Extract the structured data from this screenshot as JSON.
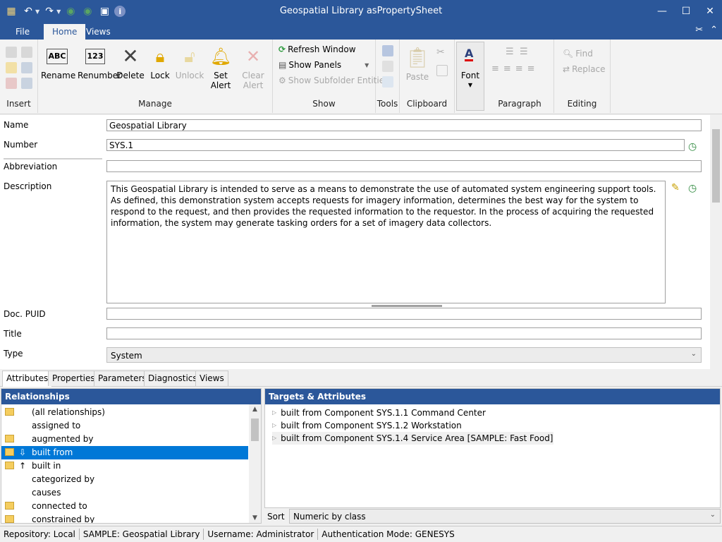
{
  "window": {
    "title": "Geospatial Library asPropertySheet"
  },
  "ribbon": {
    "tabs": [
      "File",
      "Home",
      "Views"
    ],
    "manage": {
      "rename": "Rename",
      "renumber": "Renumber",
      "delete": "Delete",
      "lock": "Lock",
      "unlock": "Unlock",
      "set_alert": "Set Alert",
      "clear_alert": "Clear Alert"
    },
    "show": {
      "refresh": "Refresh Window",
      "show_panels": "Show Panels",
      "show_subfolder": "Show Subfolder Entities"
    },
    "clipboard": {
      "paste": "Paste"
    },
    "font": {
      "label": "Font"
    },
    "editing": {
      "find": "Find",
      "replace": "Replace"
    },
    "groups": {
      "insert": "Insert",
      "manage": "Manage",
      "show": "Show",
      "tools": "Tools",
      "clipboard": "Clipboard",
      "paragraph": "Paragraph",
      "editing": "Editing"
    }
  },
  "form": {
    "name_label": "Name",
    "name_value": "Geospatial Library",
    "number_label": "Number",
    "number_value": "SYS.1",
    "abbreviation_label": "Abbreviation",
    "abbreviation_value": "",
    "description_label": "Description",
    "description_value": "This Geospatial Library is intended to serve as a means to demonstrate the use of automated system engineering support tools. As defined, this demonstration system accepts requests for imagery information, determines the best way for the system to respond to the request, and then provides the requested information to the requestor. In the process of acquiring the requested information, the system may generate tasking orders for a set of imagery data collectors.",
    "docpuid_label": "Doc. PUID",
    "docpuid_value": "",
    "title_label": "Title",
    "title_value": "",
    "type_label": "Type",
    "type_value": "System"
  },
  "lower_tabs": [
    "Attributes",
    "Properties",
    "Parameters",
    "Diagnostics",
    "Views"
  ],
  "relationships": {
    "header": "Relationships",
    "items": [
      {
        "label": "(all relationships)",
        "folder": true,
        "arrow": ""
      },
      {
        "label": "assigned to",
        "folder": false,
        "arrow": ""
      },
      {
        "label": "augmented by",
        "folder": true,
        "arrow": ""
      },
      {
        "label": "built from",
        "folder": true,
        "arrow": "⇩",
        "selected": true
      },
      {
        "label": "built in",
        "folder": true,
        "arrow": "↑"
      },
      {
        "label": "categorized by",
        "folder": false,
        "arrow": ""
      },
      {
        "label": "causes",
        "folder": false,
        "arrow": ""
      },
      {
        "label": "connected to",
        "folder": true,
        "arrow": ""
      },
      {
        "label": "constrained by",
        "folder": true,
        "arrow": ""
      }
    ]
  },
  "targets": {
    "header": "Targets & Attributes",
    "items": [
      "built from Component SYS.1.1 Command Center",
      "built from Component SYS.1.2 Workstation",
      "built from Component SYS.1.4 Service Area [SAMPLE: Fast Food]"
    ]
  },
  "sort": {
    "label": "Sort",
    "value": "Numeric by class"
  },
  "status": {
    "repository": "Repository: Local",
    "project": "SAMPLE: Geospatial Library",
    "username": "Username: Administrator",
    "auth": "Authentication Mode: GENESYS"
  },
  "colors": {
    "accent": "#2b579a",
    "selection": "#0078d7"
  },
  "icons": [
    "save-icon",
    "undo-icon",
    "redo-icon",
    "back-icon",
    "forward-icon",
    "help-icon",
    "rename-icon",
    "renumber-icon",
    "delete-icon",
    "lock-icon",
    "unlock-icon",
    "alert-bell-icon",
    "refresh-icon",
    "paste-icon",
    "font-icon",
    "history-icon",
    "edit-pencil-icon",
    "folder-icon"
  ]
}
